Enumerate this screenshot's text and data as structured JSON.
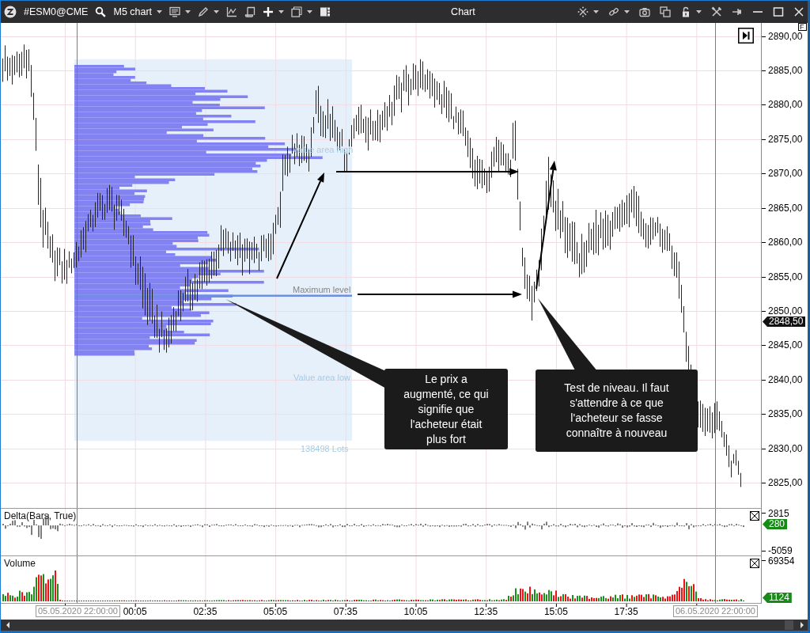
{
  "toolbar": {
    "symbol": "#ESM0@CME",
    "timeframe": "M5 chart",
    "title": "Chart"
  },
  "price_axis": {
    "corner_button": "F",
    "ticks": [
      "2890,00",
      "2885,00",
      "2880,00",
      "2875,00",
      "2870,00",
      "2865,00",
      "2860,00",
      "2855,00",
      "2850,00",
      "2845,00",
      "2840,00",
      "2835,00",
      "2830,00",
      "2825,00"
    ],
    "last_price": "2848,50"
  },
  "volume_profile": {
    "labels": [
      {
        "kind": "value_area_high",
        "text": "Value area high"
      },
      {
        "kind": "maximum_level",
        "text": "Maximum level"
      },
      {
        "kind": "value_area_low",
        "text": "Value area low"
      },
      {
        "kind": "total_volume",
        "text": "138498 Lots"
      }
    ]
  },
  "callouts": [
    {
      "text": "Le prix a augmenté, ce qui signifie que l'acheteur était plus fort"
    },
    {
      "text": "Test de niveau. Il faut s'attendre à ce que l'acheteur se fasse connaître à nouveau"
    }
  ],
  "delta_pane": {
    "title": "Delta(Bars, True)",
    "scale_max": "2815",
    "current_value": "280",
    "scale_min": "-5059"
  },
  "volume_pane": {
    "title": "Volume",
    "scale_max": "69354",
    "current_value": "1124"
  },
  "time_axis": {
    "start_date": "05.05.2020 22:00:00",
    "ticks": [
      "00:05",
      "02:35",
      "05:05",
      "07:35",
      "10:05",
      "12:35",
      "15:05",
      "17:35"
    ],
    "end_date": "06.05.2020 22:00:00"
  }
}
